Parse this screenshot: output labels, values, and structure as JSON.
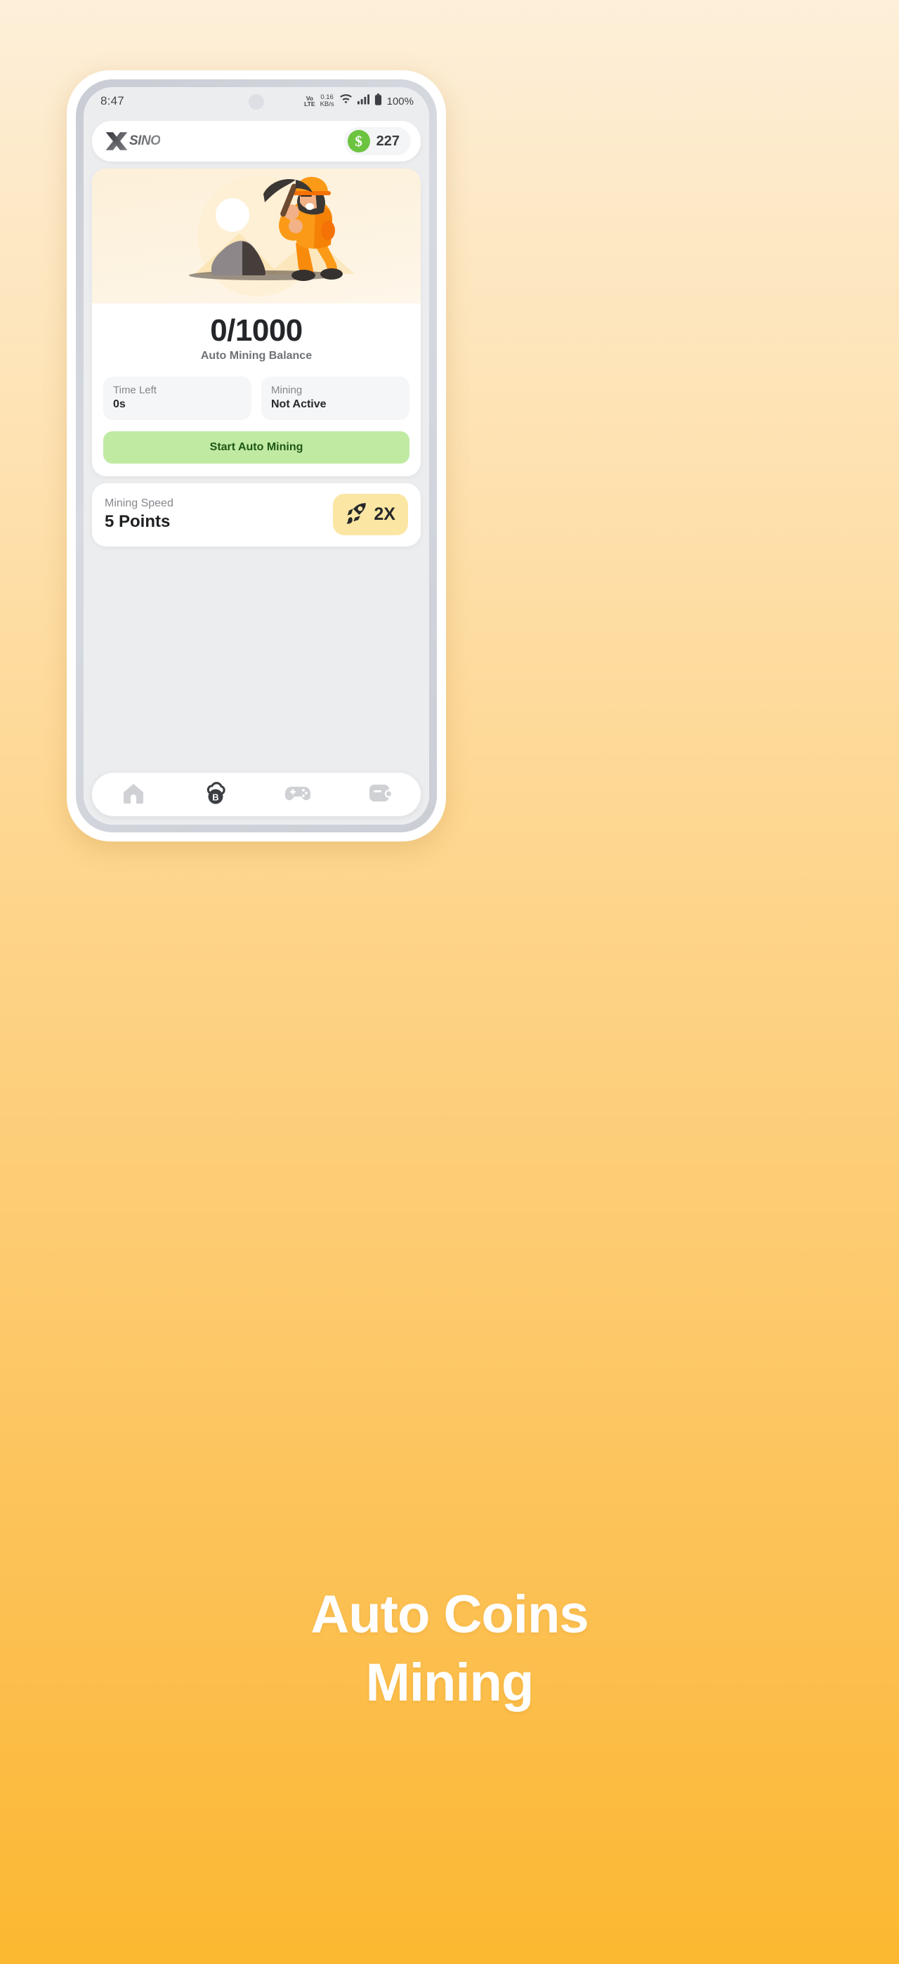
{
  "status_bar": {
    "time": "8:47",
    "volte_top": "Vo",
    "volte_bottom": "LTE",
    "net_speed_value": "0.16",
    "net_speed_unit": "KB/s",
    "wifi_icon": "wifi-icon",
    "signal_icon": "cellular-signal-icon",
    "battery_icon": "battery-full-icon",
    "battery_percent": "100%"
  },
  "app_bar": {
    "logo_mark": "x-logo-icon",
    "logo_text": "SINO",
    "coin_icon": "dollar-coin-icon",
    "coin_balance": "227"
  },
  "mining_card": {
    "illustration": "miner-with-pickaxe-illustration",
    "balance": "0/1000",
    "balance_label": "Auto Mining Balance",
    "stats": [
      {
        "label": "Time Left",
        "value": "0s"
      },
      {
        "label": "Mining",
        "value": "Not Active"
      }
    ],
    "start_button": "Start Auto Mining"
  },
  "speed_card": {
    "label": "Mining Speed",
    "value": "5 Points",
    "boost_icon": "rocket-icon",
    "boost_label": "2X"
  },
  "bottom_nav": [
    {
      "icon": "home-icon",
      "active": false
    },
    {
      "icon": "cloud-bitcoin-mining-icon",
      "active": true
    },
    {
      "icon": "gamepad-icon",
      "active": false
    },
    {
      "icon": "wallet-icon",
      "active": false
    }
  ],
  "promo": {
    "line1": "Auto Coins",
    "line2": "Mining"
  },
  "colors": {
    "bg_top": "#FDEFD9",
    "bg_bottom": "#FBB830",
    "coin_green": "#6CC33F",
    "button_green_bg": "#C0EAA2",
    "button_green_text": "#1E5716",
    "boost_yellow": "#FBE7A3",
    "hero_cream": "#FDF0D9",
    "screen_grey": "#ECEDEF",
    "miner_orange": "#F57F17"
  }
}
